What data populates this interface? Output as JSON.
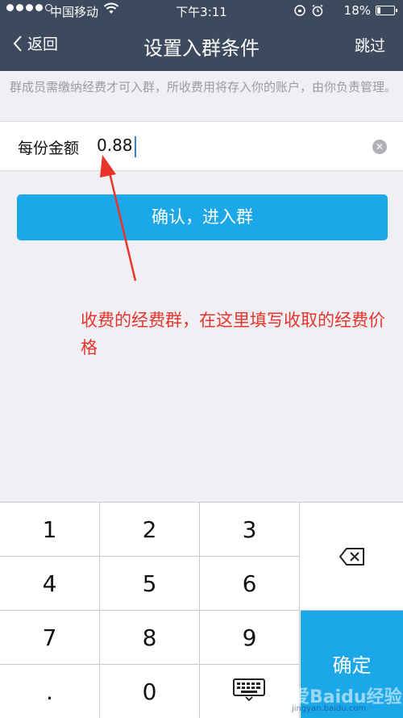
{
  "status_bar": {
    "carrier": "中国移动",
    "time": "下午3:11",
    "battery": "18%"
  },
  "nav": {
    "back_label": "返回",
    "title": "设置入群条件",
    "skip_label": "跳过"
  },
  "notice": "群成员需缴纳经费才可入群，所收费用将存入你的账户，由你负责管理。",
  "amount": {
    "label": "每份金额",
    "value": "0.88"
  },
  "confirm_button": "确认，进入群",
  "annotation": "收费的经费群，在这里填写收取的经费价格",
  "keypad": {
    "keys": [
      "1",
      "2",
      "3",
      "4",
      "5",
      "6",
      "7",
      "8",
      "9",
      ".",
      "0"
    ],
    "done_label": "确定"
  },
  "watermark": {
    "text": "我爱Baidu经验",
    "url": "jingyan.baidu.com"
  },
  "colors": {
    "nav_bg": "#3d4a5d",
    "accent": "#1ca7e8",
    "annotation": "#e8342a"
  }
}
